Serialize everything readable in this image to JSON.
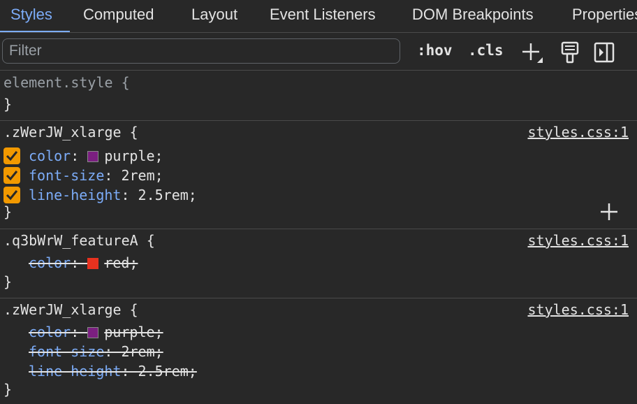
{
  "tabs": [
    {
      "label": "Styles",
      "active": true
    },
    {
      "label": "Computed",
      "active": false
    },
    {
      "label": "Layout",
      "active": false
    },
    {
      "label": "Event Listeners",
      "active": false
    },
    {
      "label": "DOM Breakpoints",
      "active": false
    },
    {
      "label": "Properties",
      "active": false
    }
  ],
  "toolbar": {
    "filter_placeholder": "Filter",
    "hov_label": ":hov",
    "cls_label": ".cls",
    "icons": [
      "new-style-rule-icon",
      "paint-brush-icon",
      "toggle-sidebar-icon"
    ]
  },
  "rules": [
    {
      "selector": "element.style {",
      "close": "}"
    },
    {
      "selector": ".zWerJW_xlarge {",
      "source": "styles.css:1",
      "close": "}",
      "properties": [
        {
          "name": "color",
          "value": "purple;",
          "swatch": "#7b1f80",
          "enabled": true,
          "overridden": false
        },
        {
          "name": "font-size",
          "value": "2rem;",
          "enabled": true,
          "overridden": false
        },
        {
          "name": "line-height",
          "value": "2.5rem;",
          "enabled": true,
          "overridden": false
        }
      ]
    },
    {
      "selector": ".q3bWrW_featureA {",
      "source": "styles.css:1",
      "close": "}",
      "properties": [
        {
          "name": "color",
          "value": "red;",
          "swatch": "#e8321f",
          "overridden": true
        }
      ]
    },
    {
      "selector": ".zWerJW_xlarge {",
      "source": "styles.css:1",
      "close": "}",
      "properties": [
        {
          "name": "color",
          "value": "purple;",
          "swatch": "#7b1f80",
          "overridden": true
        },
        {
          "name": "font-size",
          "value": "2rem;",
          "overridden": true
        },
        {
          "name": "line-height",
          "value": "2.5rem;",
          "overridden": true
        }
      ]
    }
  ],
  "colors": {
    "accent": "#7cacf8",
    "checkbox": "#f29900",
    "background": "#282828"
  }
}
